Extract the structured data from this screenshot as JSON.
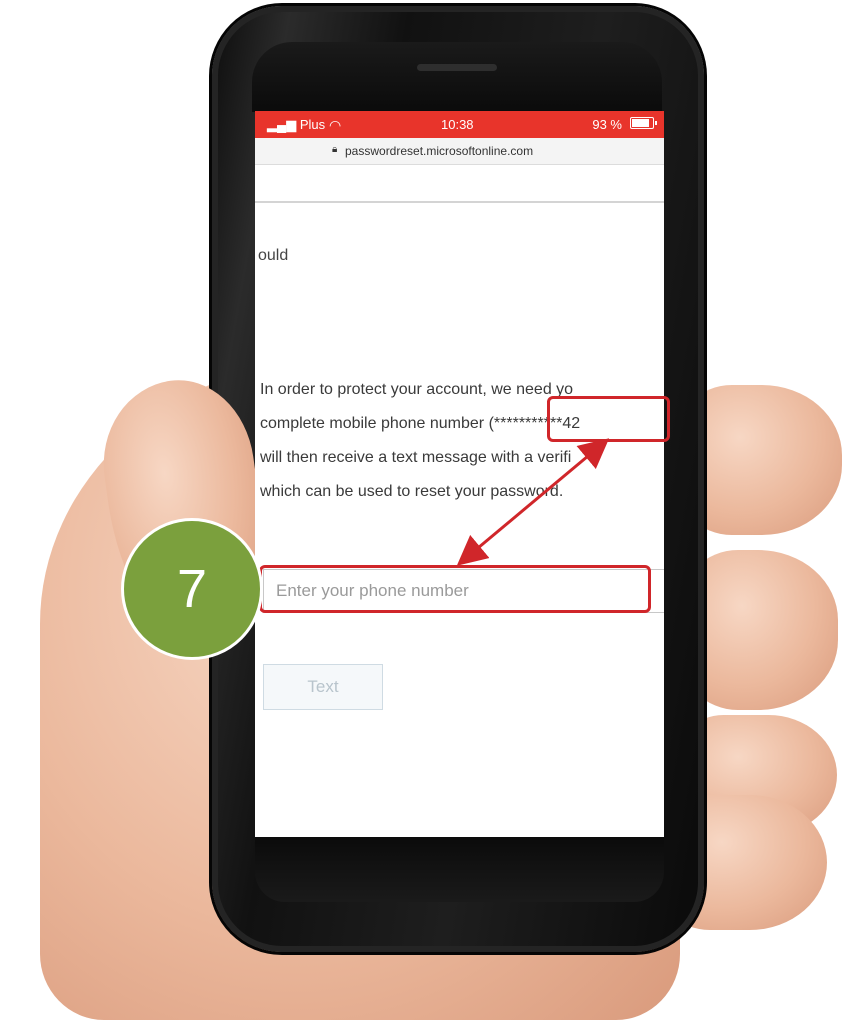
{
  "status_bar": {
    "carrier": "Plus",
    "time": "10:38",
    "battery": "93 %"
  },
  "browser": {
    "url": "passwordreset.microsoftonline.com"
  },
  "page": {
    "fragment_text": "ould",
    "instructions": [
      "In order to protect your account, we need yo",
      "complete mobile phone number (***********42",
      "will then receive a text message with a verifi",
      "which can be used to reset your password."
    ],
    "phone_input_placeholder": "Enter your phone number",
    "text_button_label": "Text"
  },
  "annotation": {
    "step_number": "7",
    "highlight_color": "#d0262a",
    "badge_color": "#7ba03d"
  }
}
